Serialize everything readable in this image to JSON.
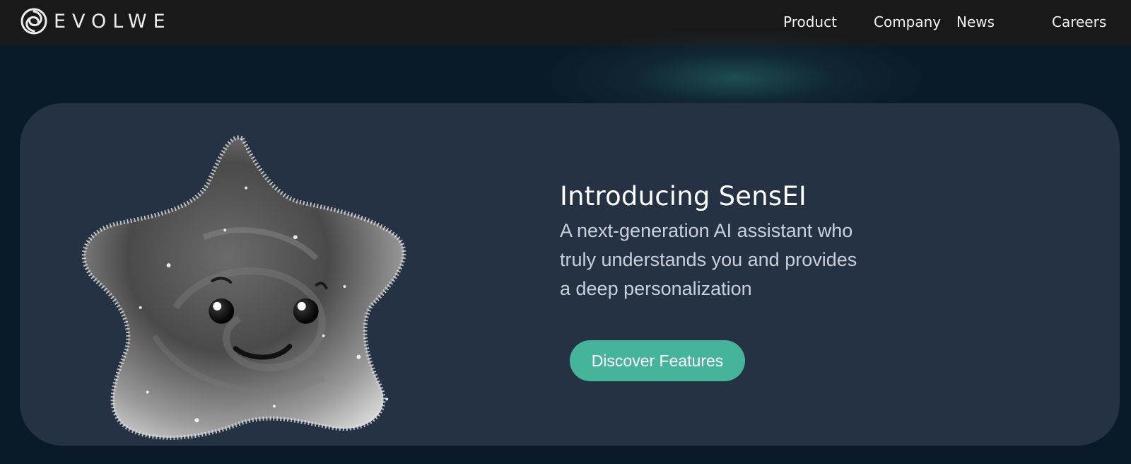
{
  "header": {
    "brand": "EVOLWE",
    "nav": [
      {
        "label": "Product"
      },
      {
        "label": "Company"
      },
      {
        "label": "News"
      },
      {
        "label": "Careers"
      }
    ]
  },
  "hero": {
    "title": "Introducing SensEI",
    "description": "A next-generation AI assistant who truly understands you and provides a deep personalization",
    "cta_label": "Discover Features",
    "image_alt": "fuzzy star mascot"
  },
  "colors": {
    "nav_bg": "#191919",
    "page_bg": "#0b1a28",
    "card_bg": "#253244",
    "accent": "#45b49b"
  }
}
